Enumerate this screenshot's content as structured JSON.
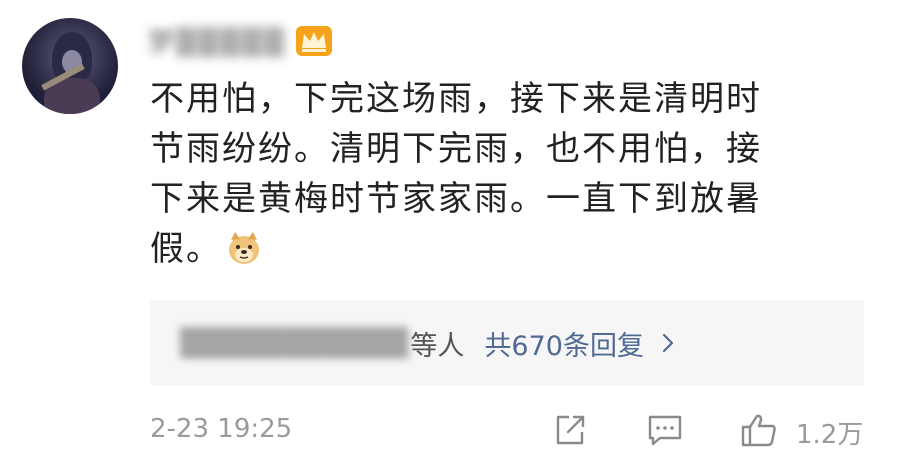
{
  "user": {
    "name_obscured": "梦▒▒▒▒▒",
    "badge_icon": "crown-icon",
    "badge_color": "#f7a21b"
  },
  "comment": {
    "lines": [
      "不用怕，下完这场雨，接下来是清明时",
      "节雨纷纷。清明下完雨，也不用怕，接",
      "下来是黄梅时节家家雨。一直下到放暑",
      "假。"
    ],
    "emoji": "doge-emoji-icon"
  },
  "replies": {
    "names_obscured": "▒▒▒▒▒▒▒▒▒▒▒",
    "others_label": "等人",
    "total_label": "共670条回复",
    "link_color": "#506a95"
  },
  "footer": {
    "timestamp": "2-23 19:25",
    "like_count": "1.2万",
    "icons": [
      "share-icon",
      "comment-icon",
      "like-icon"
    ]
  }
}
